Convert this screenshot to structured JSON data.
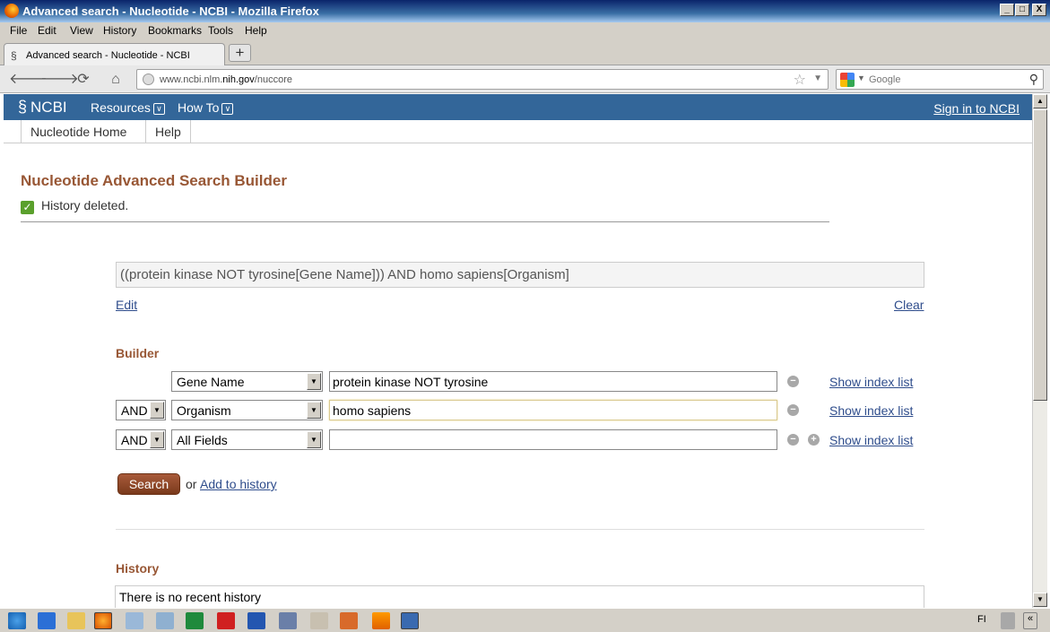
{
  "window": {
    "title": "Advanced search - Nucleotide - NCBI - Mozilla Firefox",
    "minimize": "_",
    "maximize": "□",
    "close": "X"
  },
  "menubar": {
    "items": [
      "File",
      "Edit",
      "View",
      "History",
      "Bookmarks",
      "Tools",
      "Help"
    ]
  },
  "tabs": [
    {
      "label": "Advanced search - Nucleotide - NCBI"
    }
  ],
  "newtab_label": "+",
  "addressbar": {
    "url_prefix": "www.ncbi.nlm.",
    "url_domain": "nih.gov",
    "url_path": "/nuccore"
  },
  "search_engine": {
    "placeholder": "Google"
  },
  "ncbi": {
    "logo": "NCBI",
    "resources": "Resources",
    "howto": "How To",
    "signin": "Sign in to NCBI",
    "subnav": [
      "Nucleotide Home",
      "Help"
    ]
  },
  "page": {
    "title": "Nucleotide Advanced Search Builder",
    "message": "History deleted.",
    "query": "((protein kinase NOT tyrosine[Gene Name])) AND homo sapiens[Organism]",
    "edit": "Edit",
    "clear": "Clear",
    "builder_heading": "Builder",
    "rows": [
      {
        "op": "",
        "field": "Gene Name",
        "term": "protein kinase NOT tyrosine",
        "show_index": "Show index list"
      },
      {
        "op": "AND",
        "field": "Organism",
        "term": "homo sapiens",
        "show_index": "Show index list"
      },
      {
        "op": "AND",
        "field": "All Fields",
        "term": "",
        "show_index": "Show index list"
      }
    ],
    "search_button": "Search",
    "or_text": "or",
    "add_to_history": "Add to history",
    "history_heading": "History",
    "history_empty": "There is no recent history"
  },
  "taskbar": {
    "language": "FI"
  },
  "colors": {
    "ncbi_blue": "#336699",
    "heading_brown": "#985735",
    "link_blue": "#2f4d8c"
  }
}
